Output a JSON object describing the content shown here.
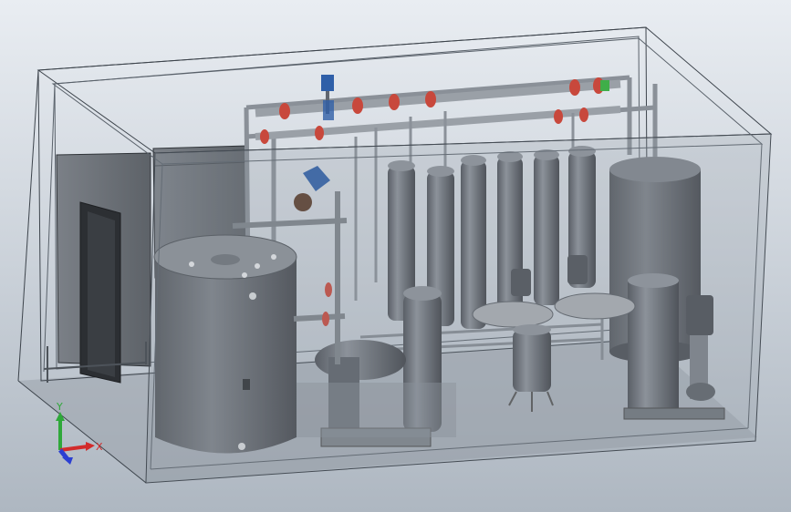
{
  "viewport": {
    "background_top": "#e9edf2",
    "background_bottom": "#aeb7c1"
  },
  "model": {
    "enclosure_edge_color": "#3c434b",
    "equipment_color": "#6b7078",
    "pipe_accent_color": "#c8483c",
    "valve_accent_color": "#2f5fa8",
    "indicator_accent_color": "#3fae49"
  },
  "triad": {
    "x_label": "X",
    "y_label": "Y",
    "x_color": "#d22b2b",
    "y_color": "#2fa83a",
    "z_color": "#2b3fd2"
  }
}
